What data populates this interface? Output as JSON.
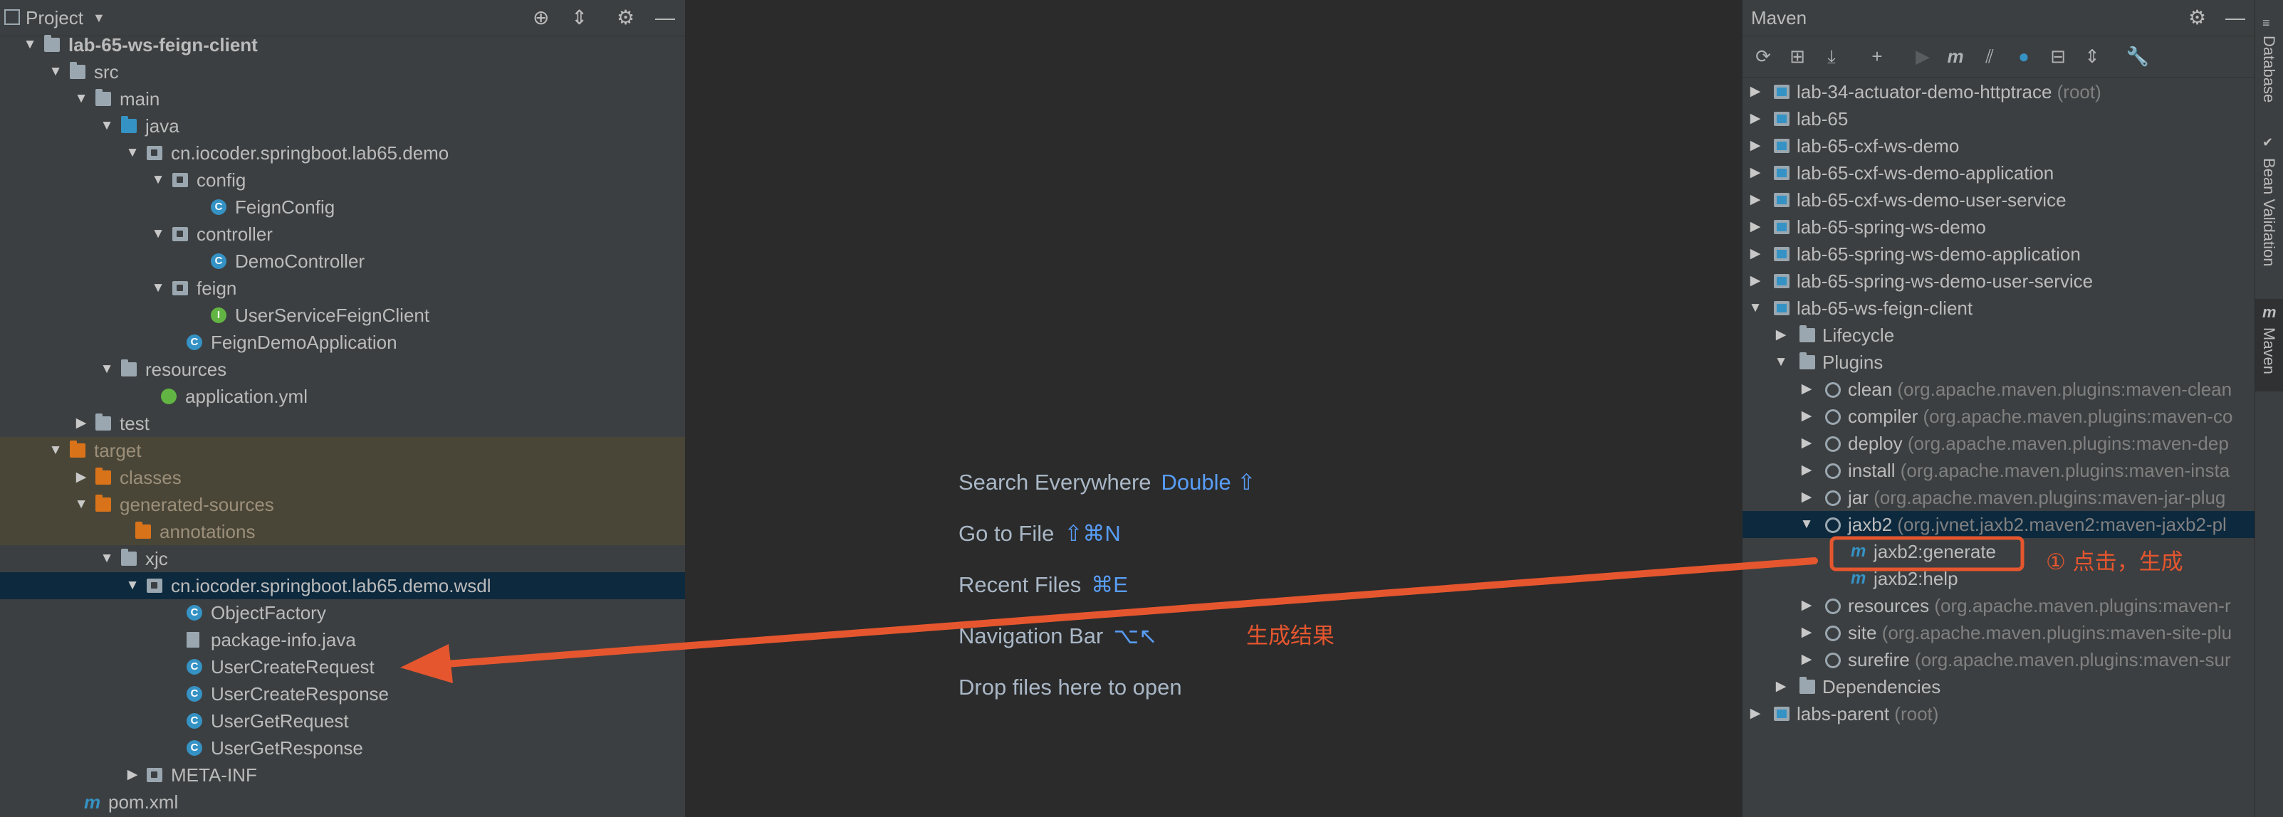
{
  "project": {
    "title": "Project",
    "tree": [
      {
        "label": "lab-65-ws-feign-client",
        "arrow": "▼",
        "icon": "folder-gray",
        "bold": true
      },
      {
        "label": "src",
        "arrow": "▼",
        "icon": "folder-gray"
      },
      {
        "label": "main",
        "arrow": "▼",
        "icon": "folder-gray"
      },
      {
        "label": "java",
        "arrow": "▼",
        "icon": "folder-blue"
      },
      {
        "label": "cn.iocoder.springboot.lab65.demo",
        "arrow": "▼",
        "icon": "pkg"
      },
      {
        "label": "config",
        "arrow": "▼",
        "icon": "pkg"
      },
      {
        "label": "FeignConfig",
        "icon": "class"
      },
      {
        "label": "controller",
        "arrow": "▼",
        "icon": "pkg"
      },
      {
        "label": "DemoController",
        "icon": "class"
      },
      {
        "label": "feign",
        "arrow": "▼",
        "icon": "pkg"
      },
      {
        "label": "UserServiceFeignClient",
        "icon": "interface"
      },
      {
        "label": "FeignDemoApplication",
        "icon": "class"
      },
      {
        "label": "resources",
        "arrow": "▼",
        "icon": "folder-gray"
      },
      {
        "label": "application.yml",
        "icon": "yml"
      },
      {
        "label": "test",
        "arrow": "▶",
        "icon": "folder-gray"
      },
      {
        "label": "target",
        "arrow": "▼",
        "icon": "folder-orange"
      },
      {
        "label": "classes",
        "arrow": "▶",
        "icon": "folder-orange"
      },
      {
        "label": "generated-sources",
        "arrow": "▼",
        "icon": "folder-orange"
      },
      {
        "label": "annotations",
        "icon": "folder-orange"
      },
      {
        "label": "xjc",
        "arrow": "▼",
        "icon": "folder-gray"
      },
      {
        "label": "cn.iocoder.springboot.lab65.demo.wsdl",
        "arrow": "▼",
        "icon": "pkg"
      },
      {
        "label": "ObjectFactory",
        "icon": "class"
      },
      {
        "label": "package-info.java",
        "icon": "file"
      },
      {
        "label": "UserCreateRequest",
        "icon": "class"
      },
      {
        "label": "UserCreateResponse",
        "icon": "class"
      },
      {
        "label": "UserGetRequest",
        "icon": "class"
      },
      {
        "label": "UserGetResponse",
        "icon": "class"
      },
      {
        "label": "META-INF",
        "arrow": "▶",
        "icon": "pkg"
      },
      {
        "label": "pom.xml",
        "icon": "maven"
      }
    ]
  },
  "center": {
    "hints": [
      {
        "label": "Search Everywhere",
        "key": "Double ⇧"
      },
      {
        "label": "Go to File",
        "key": "⇧⌘N"
      },
      {
        "label": "Recent Files",
        "key": "⌘E"
      },
      {
        "label": "Navigation Bar",
        "key": "⌥↖"
      },
      {
        "label": "Drop files here to open",
        "key": ""
      }
    ],
    "annotation_result": "生成结果"
  },
  "maven": {
    "title": "Maven",
    "tree": [
      {
        "label": "lab-34-actuator-demo-httptrace",
        "suffix": "(root)",
        "arrow": "▶",
        "icon": "module"
      },
      {
        "label": "lab-65",
        "suffix": "",
        "arrow": "▶",
        "icon": "module"
      },
      {
        "label": "lab-65-cxf-ws-demo",
        "suffix": "",
        "arrow": "▶",
        "icon": "module"
      },
      {
        "label": "lab-65-cxf-ws-demo-application",
        "suffix": "",
        "arrow": "▶",
        "icon": "module"
      },
      {
        "label": "lab-65-cxf-ws-demo-user-service",
        "suffix": "",
        "arrow": "▶",
        "icon": "module"
      },
      {
        "label": "lab-65-spring-ws-demo",
        "suffix": "",
        "arrow": "▶",
        "icon": "module"
      },
      {
        "label": "lab-65-spring-ws-demo-application",
        "suffix": "",
        "arrow": "▶",
        "icon": "module"
      },
      {
        "label": "lab-65-spring-ws-demo-user-service",
        "suffix": "",
        "arrow": "▶",
        "icon": "module"
      },
      {
        "label": "lab-65-ws-feign-client",
        "suffix": "",
        "arrow": "▼",
        "icon": "module"
      },
      {
        "label": "Lifecycle",
        "suffix": "",
        "arrow": "▶",
        "icon": "folder-gear"
      },
      {
        "label": "Plugins",
        "suffix": "",
        "arrow": "▼",
        "icon": "folder-gear"
      },
      {
        "label": "clean",
        "suffix": "(org.apache.maven.plugins:maven-clean",
        "arrow": "▶",
        "icon": "plugin"
      },
      {
        "label": "compiler",
        "suffix": "(org.apache.maven.plugins:maven-co",
        "arrow": "▶",
        "icon": "plugin"
      },
      {
        "label": "deploy",
        "suffix": "(org.apache.maven.plugins:maven-dep",
        "arrow": "▶",
        "icon": "plugin"
      },
      {
        "label": "install",
        "suffix": "(org.apache.maven.plugins:maven-insta",
        "arrow": "▶",
        "icon": "plugin"
      },
      {
        "label": "jar",
        "suffix": "(org.apache.maven.plugins:maven-jar-plug",
        "arrow": "▶",
        "icon": "plugin"
      },
      {
        "label": "jaxb2",
        "suffix": "(org.jvnet.jaxb2.maven2:maven-jaxb2-pl",
        "arrow": "▼",
        "icon": "plugin"
      },
      {
        "label": "jaxb2:generate",
        "suffix": "",
        "arrow": "",
        "icon": "goal"
      },
      {
        "label": "jaxb2:help",
        "suffix": "",
        "arrow": "",
        "icon": "goal"
      },
      {
        "label": "resources",
        "suffix": "(org.apache.maven.plugins:maven-r",
        "arrow": "▶",
        "icon": "plugin"
      },
      {
        "label": "site",
        "suffix": "(org.apache.maven.plugins:maven-site-plu",
        "arrow": "▶",
        "icon": "plugin"
      },
      {
        "label": "surefire",
        "suffix": "(org.apache.maven.plugins:maven-sur",
        "arrow": "▶",
        "icon": "plugin"
      },
      {
        "label": "Dependencies",
        "suffix": "",
        "arrow": "▶",
        "icon": "folder-gear"
      },
      {
        "label": "labs-parent",
        "suffix": "(root)",
        "arrow": "▶",
        "icon": "module"
      }
    ],
    "annotation_click": "① 点击，生成"
  },
  "right_strip": {
    "tabs": [
      "Database",
      "Bean Validation",
      "Maven"
    ]
  },
  "colors": {
    "annotation": "#e5562f",
    "selection": "#0d293e",
    "link_key": "#589df6"
  }
}
